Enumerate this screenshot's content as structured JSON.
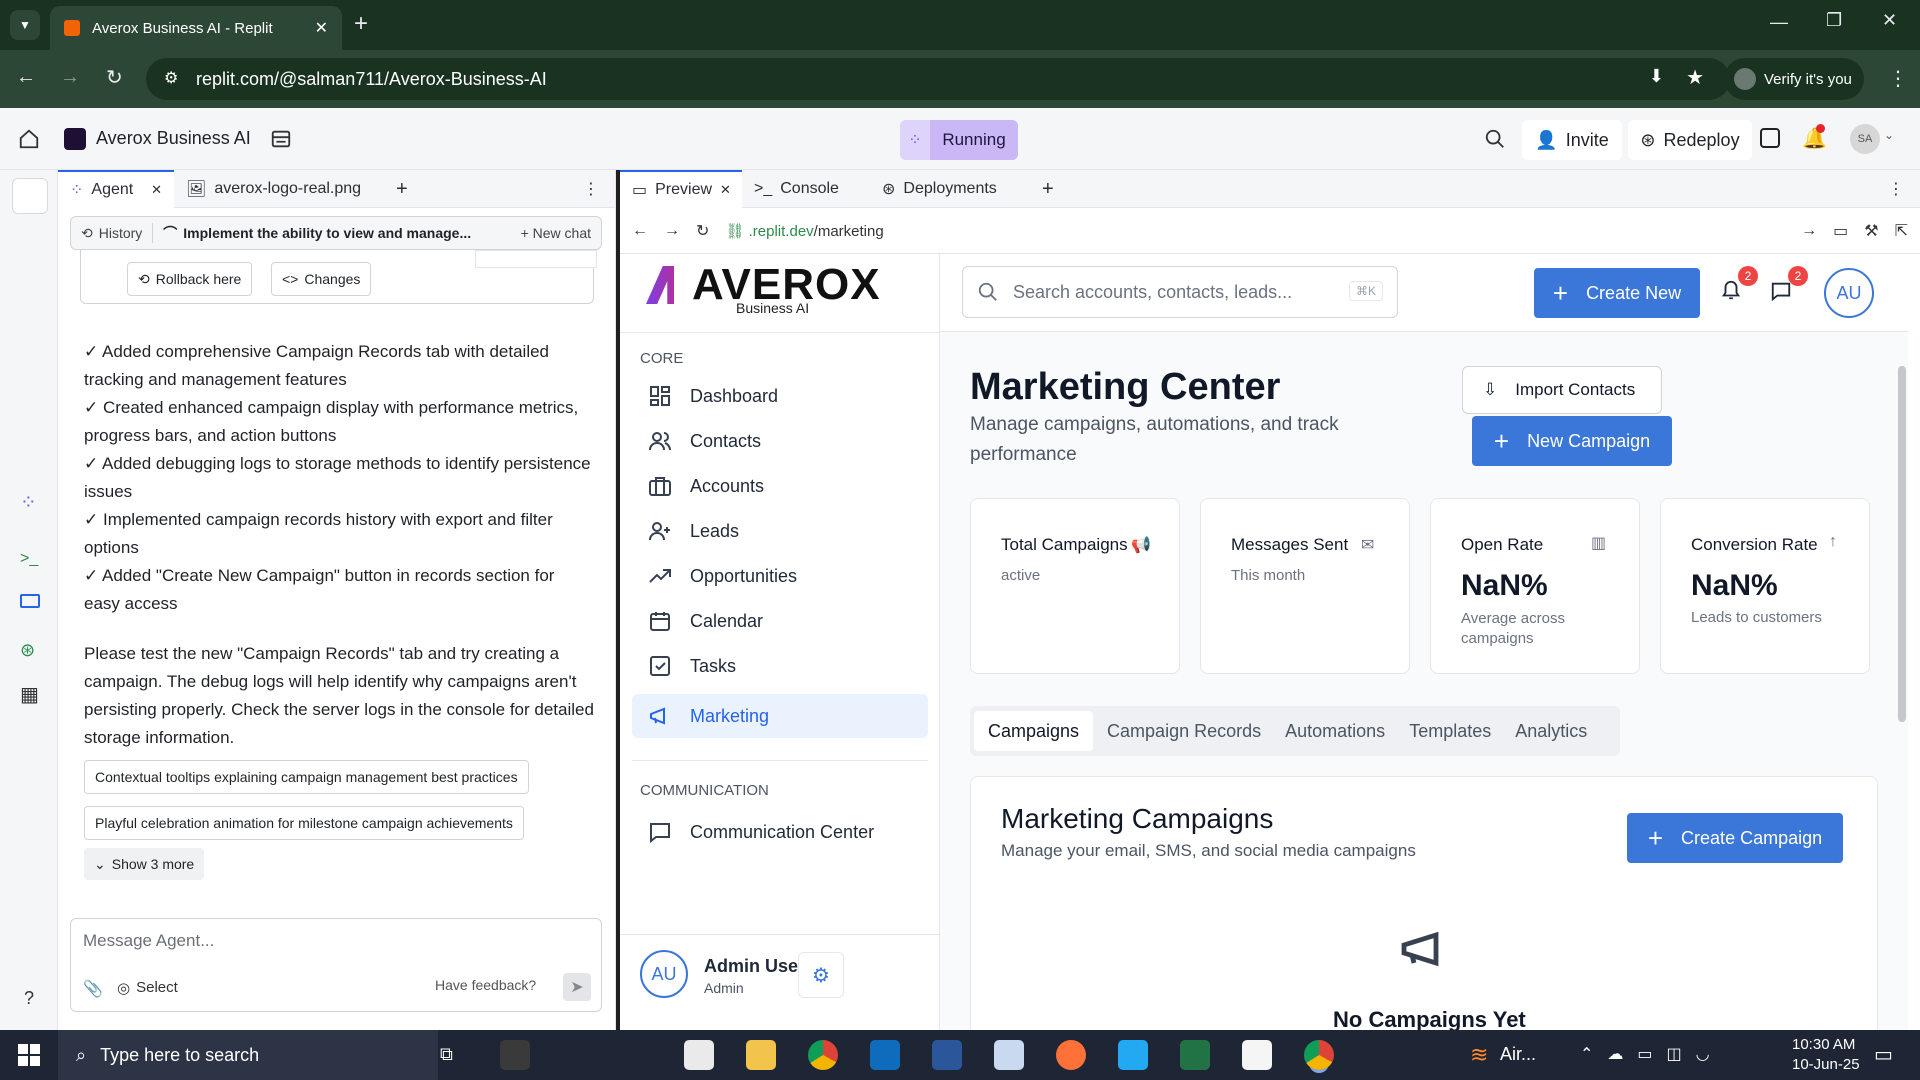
{
  "browser": {
    "tab_title": "Averox Business AI - Replit",
    "url": "replit.com/@salman711/Averox-Business-AI",
    "verify_label": "Verify it's you"
  },
  "replit": {
    "project_name": "Averox Business AI",
    "status": "Running",
    "invite_label": "Invite",
    "redeploy_label": "Redeploy",
    "avatar": "SA",
    "left_tabs": [
      "Agent",
      "averox-logo-real.png"
    ],
    "right_tabs": [
      "Preview",
      "Console",
      "Deployments"
    ],
    "preview_url_prefix": ".replit.dev",
    "preview_url_path": "/marketing",
    "help": "?"
  },
  "agent": {
    "history_label": "History",
    "chat_title": "Implement the ability to view and manage...",
    "new_chat_label": "New chat",
    "rollback_label": "Rollback here",
    "changes_label": "Changes",
    "checklist": [
      "✓ Added comprehensive Campaign Records tab with detailed tracking and management features",
      "✓ Created enhanced campaign display with performance metrics, progress bars, and action buttons",
      "✓ Added debugging logs to storage methods to identify persistence issues",
      "✓ Implemented campaign records history with export and filter options",
      "✓ Added \"Create New Campaign\" button in records section for easy access"
    ],
    "message": "Please test the new \"Campaign Records\" tab and try creating a campaign. The debug logs will help identify why campaigns aren't persisting properly. Check the server logs in the console for detailed storage information.",
    "suggestions": [
      "Contextual tooltips explaining campaign management best practices",
      "Playful celebration animation for milestone campaign achievements"
    ],
    "show_more_label": "Show 3 more",
    "input_placeholder": "Message Agent...",
    "select_label": "Select",
    "feedback_label": "Have feedback?"
  },
  "app": {
    "logo_text": "AVEROX",
    "logo_sub": "Business AI",
    "search_placeholder": "Search accounts, contacts, leads...",
    "search_shortcut": "⌘K",
    "create_new_label": "Create New",
    "notif_count": "2",
    "msg_count": "2",
    "user_initials": "AU",
    "core_heading": "CORE",
    "nav_core": [
      "Dashboard",
      "Contacts",
      "Accounts",
      "Leads",
      "Opportunities",
      "Calendar",
      "Tasks",
      "Marketing"
    ],
    "comm_heading": "COMMUNICATION",
    "nav_comm": [
      "Communication Center"
    ],
    "user_name": "Admin User",
    "user_role": "Admin",
    "page_title": "Marketing Center",
    "page_subtitle": "Manage campaigns, automations, and track performance",
    "import_label": "Import Contacts",
    "new_campaign_label": "New Campaign",
    "stats": [
      {
        "title": "Total Campaigns",
        "value": "",
        "sub": "active",
        "icon": "megaphone-icon"
      },
      {
        "title": "Messages Sent",
        "value": "",
        "sub": "This month",
        "icon": "mail-icon"
      },
      {
        "title": "Open Rate",
        "value": "NaN%",
        "sub": "Average across campaigns",
        "icon": "bar-chart-icon"
      },
      {
        "title": "Conversion Rate",
        "value": "NaN%",
        "sub": "Leads to customers",
        "icon": "arrow-up-icon"
      }
    ],
    "tabs": [
      "Campaigns",
      "Campaign Records",
      "Automations",
      "Templates",
      "Analytics"
    ],
    "section_title": "Marketing Campaigns",
    "section_subtitle": "Manage your email, SMS, and social media campaigns",
    "create_campaign_label": "Create Campaign",
    "empty_title": "No Campaigns Yet"
  },
  "taskbar": {
    "search_placeholder": "Type here to search",
    "weather": "Air...",
    "time": "10:30 AM",
    "date": "10-Jun-25"
  },
  "colors": {
    "accent": "#3b76d9",
    "chrome_green": "#2d4736",
    "running": "#c9b8f5"
  }
}
